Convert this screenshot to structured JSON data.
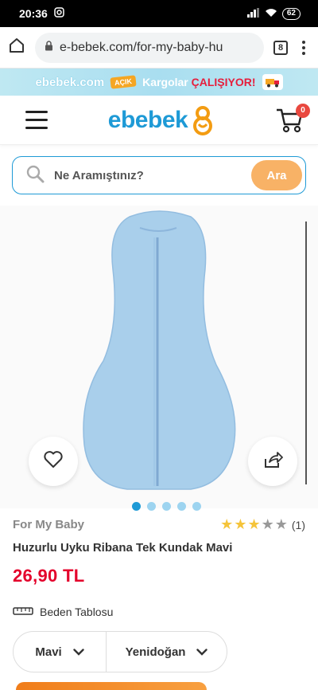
{
  "status_bar": {
    "time": "20:36",
    "battery": "62"
  },
  "browser": {
    "url": "e-bebek.com/for-my-baby-hu",
    "tab_count": "8"
  },
  "promo": {
    "logo": "ebebek.com",
    "badge": "AÇIK",
    "text_prefix": "Kargolar",
    "text_emphasis": "ÇALIŞIYOR!"
  },
  "header": {
    "logo": "ebebek",
    "cart_count": "0"
  },
  "search": {
    "placeholder": "Ne Aramıştınız?",
    "button": "Ara"
  },
  "gallery": {
    "image_count": 5,
    "active_index": 0
  },
  "product": {
    "brand": "For My Baby",
    "rating": {
      "stars": 3,
      "max": 5,
      "count": "(1)"
    },
    "title": "Huzurlu Uyku Ribana Tek Kundak Mavi",
    "price": "26,90 TL",
    "size_table_label": "Beden Tablosu",
    "color_select": "Mavi",
    "size_select": "Yenidoğan"
  },
  "colors": {
    "accent": "#1e9ad6",
    "price": "#e4002b",
    "search_button": "#f8b266",
    "product": "#a9cfeb"
  }
}
